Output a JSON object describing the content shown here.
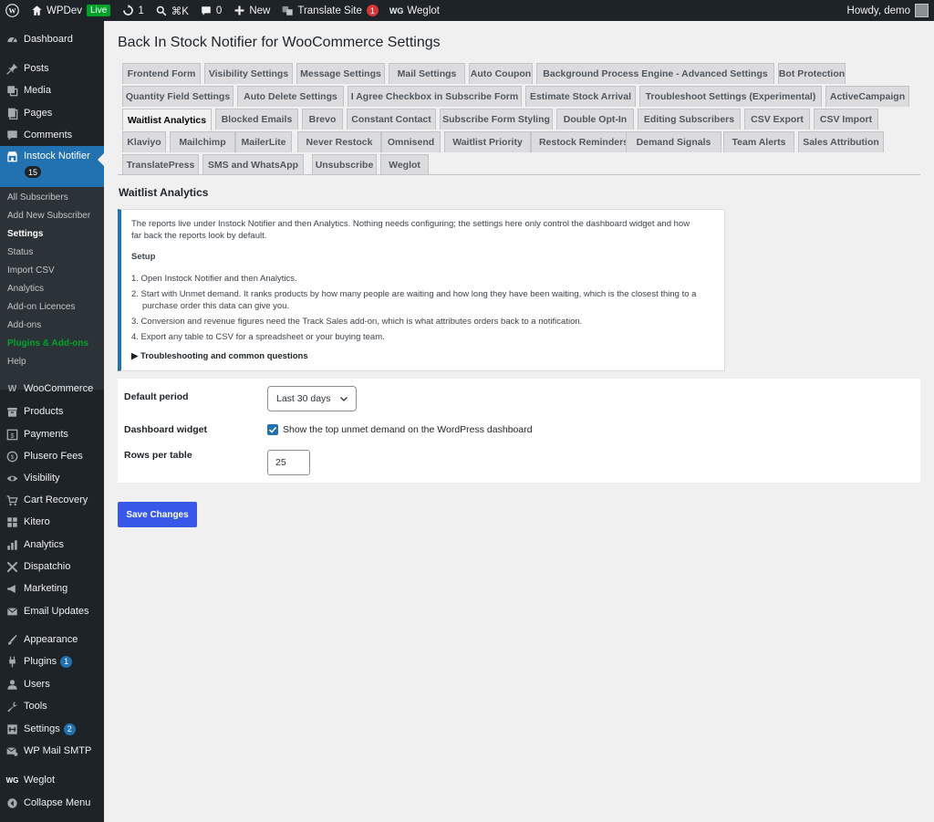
{
  "adminbar": {
    "site_name": "WPDev",
    "live_badge": "Live",
    "updates_count": "1",
    "search_shortcut": "⌘K",
    "comments_count": "0",
    "new_label": "New",
    "translate_label": "Translate Site",
    "translate_badge": "1",
    "weglot_label": "Weglot",
    "greeting": "Howdy, demo"
  },
  "sidebar": {
    "dashboard": "Dashboard",
    "posts": "Posts",
    "media": "Media",
    "pages": "Pages",
    "comments": "Comments",
    "instock": "Instock Notifier",
    "instock_badge": "15",
    "submenu": [
      "All Subscribers",
      "Add New Subscriber",
      "Settings",
      "Status",
      "Import CSV",
      "Analytics",
      "Add-on Licences",
      "Add-ons",
      "Plugins & Add-ons",
      "Help"
    ],
    "woocommerce": "WooCommerce",
    "products": "Products",
    "payments": "Payments",
    "plusero": "Plusero Fees",
    "visibility": "Visibility",
    "cart_recovery": "Cart Recovery",
    "kitero": "Kitero",
    "analytics": "Analytics",
    "dispatchio": "Dispatchio",
    "marketing": "Marketing",
    "email_updates": "Email Updates",
    "appearance": "Appearance",
    "plugins": "Plugins",
    "plugins_badge": "1",
    "users": "Users",
    "tools": "Tools",
    "settings": "Settings",
    "settings_badge": "2",
    "wp_mail_smtp": "WP Mail SMTP",
    "weglot": "Weglot",
    "collapse": "Collapse Menu"
  },
  "page": {
    "title": "Back In Stock Notifier for WooCommerce Settings",
    "tabs": [
      "Frontend Form",
      "Visibility Settings",
      "Message Settings",
      "Mail Settings",
      "Auto Coupon",
      "Background Process Engine - Advanced Settings",
      "Bot Protection",
      "Quantity Field Settings",
      "Auto Delete Settings",
      "I Agree Checkbox in Subscribe Form",
      "Estimate Stock Arrival",
      "Troubleshoot Settings (Experimental)",
      "ActiveCampaign",
      "Waitlist Analytics",
      "Blocked Emails",
      "Brevo",
      "Constant Contact",
      "Subscribe Form Styling",
      "Double Opt-In",
      "Editing Subscribers",
      "CSV Export",
      "CSV Import",
      "Klaviyo",
      "Mailchimp",
      "MailerLite",
      "Never Restock",
      "Omnisend",
      "Waitlist Priority",
      "Restock Reminders",
      "Demand Signals",
      "Team Alerts",
      "Sales Attribution",
      "TranslatePress",
      "SMS and WhatsApp",
      "Unsubscribe",
      "Weglot"
    ],
    "active_tab": "Waitlist Analytics",
    "section_title": "Waitlist Analytics"
  },
  "notice": {
    "intro_line1": "The reports live under Instock Notifier and then Analytics. Nothing needs configuring; the settings here only control the dashboard widget and how",
    "intro_line2": "far back the reports look by default.",
    "setup_heading": "Setup",
    "step1": "1. Open Instock Notifier and then Analytics.",
    "step2_line1": "2. Start with Unmet demand. It ranks products by how many people are waiting and how long they have been waiting, which is the closest thing to a",
    "step2_line2": "purchase order this data can give you.",
    "step3": "3. Conversion and revenue figures need the Track Sales add-on, which is what attributes orders back to a notification.",
    "step4": "4. Export any table to CSV for a spreadsheet or your buying team.",
    "troubleshooting": "▶ Troubleshooting and common questions"
  },
  "form": {
    "default_period_label": "Default period",
    "default_period_value": "Last 30 days",
    "dashboard_widget_label": "Dashboard widget",
    "dashboard_widget_checked": true,
    "dashboard_widget_text": "Show the top unmet demand on the WordPress dashboard",
    "rows_per_table_label": "Rows per table",
    "rows_per_table_value": "25"
  },
  "save_label": "Save Changes",
  "colors": {
    "admin_dark": "#1d2327",
    "accent_blue": "#2271b1",
    "save_blue": "#3858e9",
    "live_green": "#00a32a",
    "badge_red": "#d63638"
  }
}
